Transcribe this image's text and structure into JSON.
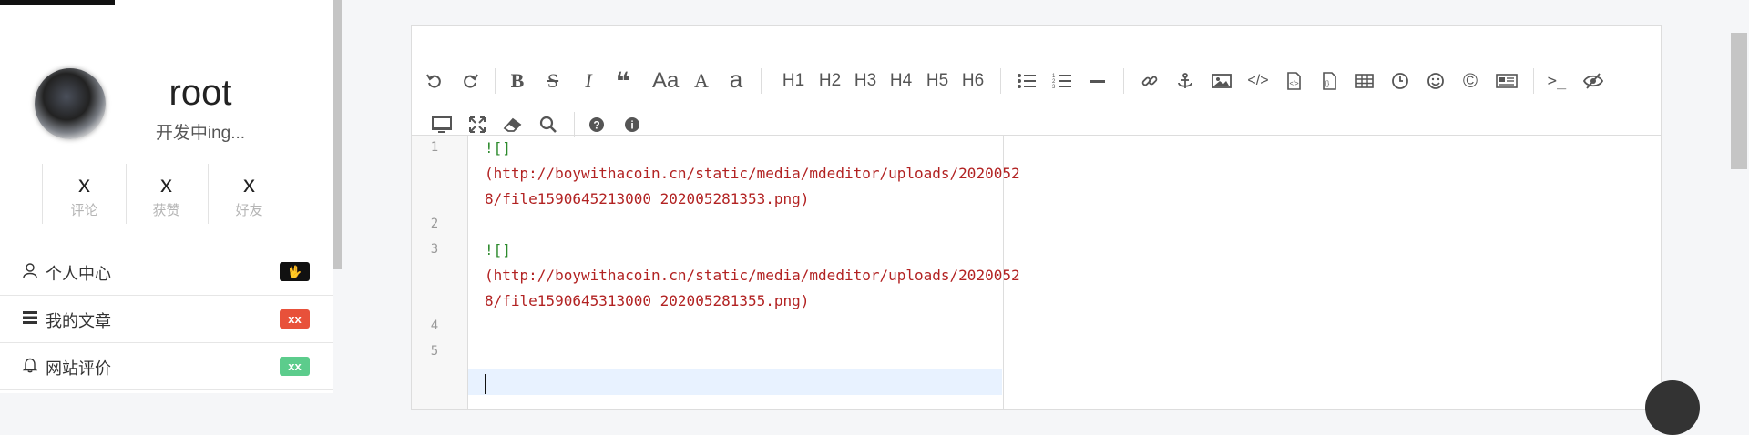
{
  "profile": {
    "username": "root",
    "subtitle": "开发中ing...",
    "stats": [
      {
        "value": "x",
        "label": "评论"
      },
      {
        "value": "x",
        "label": "获赞"
      },
      {
        "value": "x",
        "label": "好友"
      }
    ]
  },
  "menu": [
    {
      "icon": "user-icon",
      "label": "个人中心",
      "badge": "🖖",
      "badge_color": "#111111"
    },
    {
      "icon": "list-icon",
      "label": "我的文章",
      "badge": "xx",
      "badge_color": "#e8513a"
    },
    {
      "icon": "bell-icon",
      "label": "网站评价",
      "badge": "xx",
      "badge_color": "#5ccc8c"
    }
  ],
  "toolbar": {
    "headings": [
      "H1",
      "H2",
      "H3",
      "H4",
      "H5",
      "H6"
    ],
    "text_tools": {
      "font_size": "Aa",
      "upper": "A",
      "lower": "a"
    },
    "terminal": ">_"
  },
  "editor": {
    "line_numbers": [
      "1",
      "2",
      "3",
      "4",
      "5"
    ],
    "lines": [
      {
        "mark": "![]",
        "url1": "(http://boywithacoin.cn/static/media/mdeditor/uploads/2020052",
        "url2": "8/file1590645213000_202005281353.png)"
      },
      {
        "mark": "![]",
        "url1": "(http://boywithacoin.cn/static/media/mdeditor/uploads/2020052",
        "url2": "8/file1590645313000_202005281355.png)"
      }
    ]
  }
}
